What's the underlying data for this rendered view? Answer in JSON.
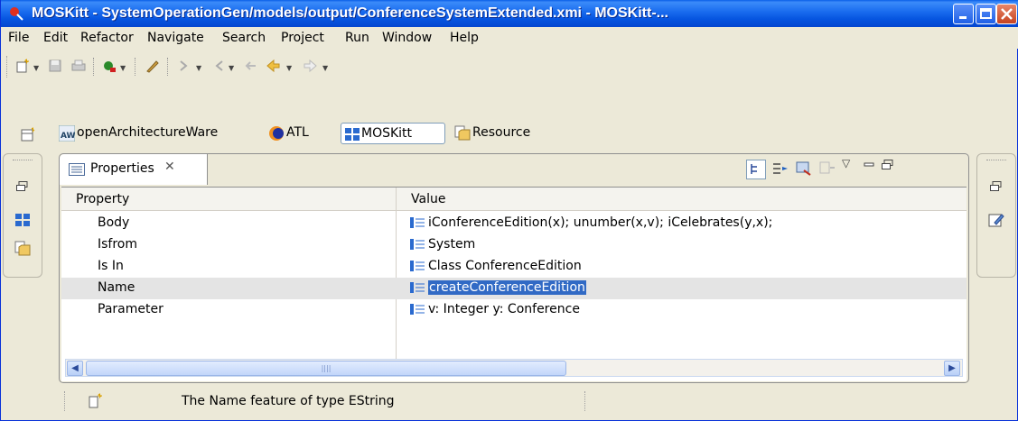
{
  "window": {
    "title": "MOSKitt - SystemOperationGen/models/output/ConferenceSystemExtended.xmi - MOSKitt-..."
  },
  "menu": [
    "File",
    "Edit",
    "Refactor",
    "Navigate",
    "Search",
    "Project",
    "Run",
    "Window",
    "Help"
  ],
  "perspectives": [
    {
      "label": "openArchitectureWare",
      "icon": "oaw-icon",
      "active": false
    },
    {
      "label": "ATL",
      "icon": "atl-icon",
      "active": false
    },
    {
      "label": "MOSKitt",
      "icon": "moskitt-icon",
      "active": true
    },
    {
      "label": "Resource",
      "icon": "resource-icon",
      "active": false
    }
  ],
  "view": {
    "tab_label": "Properties",
    "columns": [
      "Property",
      "Value"
    ],
    "rows": [
      {
        "property": "Body",
        "value": "iConferenceEdition(x); unumber(x,v);  iCelebrates(y,x);"
      },
      {
        "property": "Isfrom",
        "value": "System"
      },
      {
        "property": "Is In",
        "value": "Class ConferenceEdition"
      },
      {
        "property": "Name",
        "value": "createConferenceEdition",
        "selected": true
      },
      {
        "property": "Parameter",
        "value": " v: Integer y: Conference"
      }
    ]
  },
  "status": {
    "text": "The Name feature of type EString"
  },
  "colors": {
    "titlebar": "#0655e0",
    "selection": "#316ac5",
    "close_button": "#c64320"
  }
}
